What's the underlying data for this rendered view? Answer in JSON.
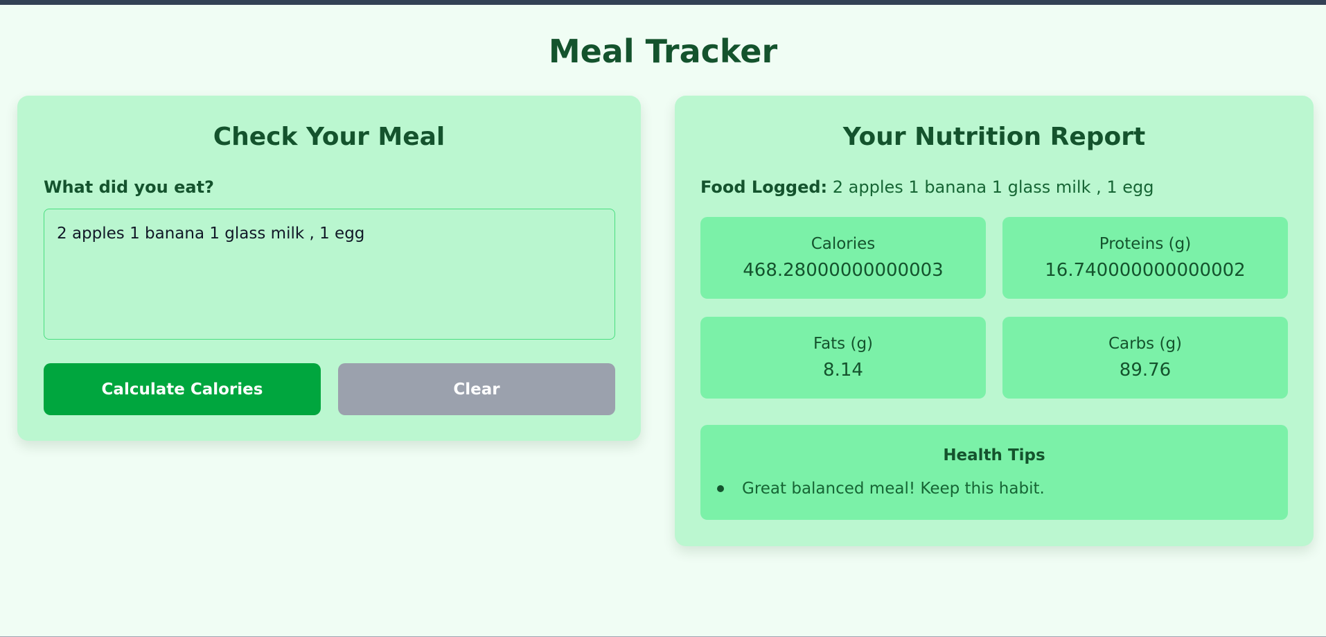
{
  "app": {
    "title": "Meal Tracker"
  },
  "input_panel": {
    "title": "Check Your Meal",
    "label": "What did you eat?",
    "meal_value": "2 apples 1 banana 1 glass milk , 1 egg",
    "calculate_label": "Calculate Calories",
    "clear_label": "Clear"
  },
  "report_panel": {
    "title": "Your Nutrition Report",
    "food_logged_label": "Food Logged:",
    "food_logged_value": "2 apples 1 banana 1 glass milk , 1 egg",
    "stats": {
      "calories": {
        "label": "Calories",
        "value": "468.28000000000003"
      },
      "proteins": {
        "label": "Proteins (g)",
        "value": "16.740000000000002"
      },
      "fats": {
        "label": "Fats (g)",
        "value": "8.14"
      },
      "carbs": {
        "label": "Carbs (g)",
        "value": "89.76"
      }
    },
    "health_tips": {
      "title": "Health Tips",
      "items": [
        "Great balanced meal! Keep this habit."
      ]
    }
  },
  "colors": {
    "page_bg": "#f0fdf4",
    "card_bg": "#bbf7d0",
    "stat_bg": "#7bf1a8",
    "primary_button": "#00a63e",
    "secondary_button": "#9ba1ad",
    "heading_text": "#14532d"
  }
}
